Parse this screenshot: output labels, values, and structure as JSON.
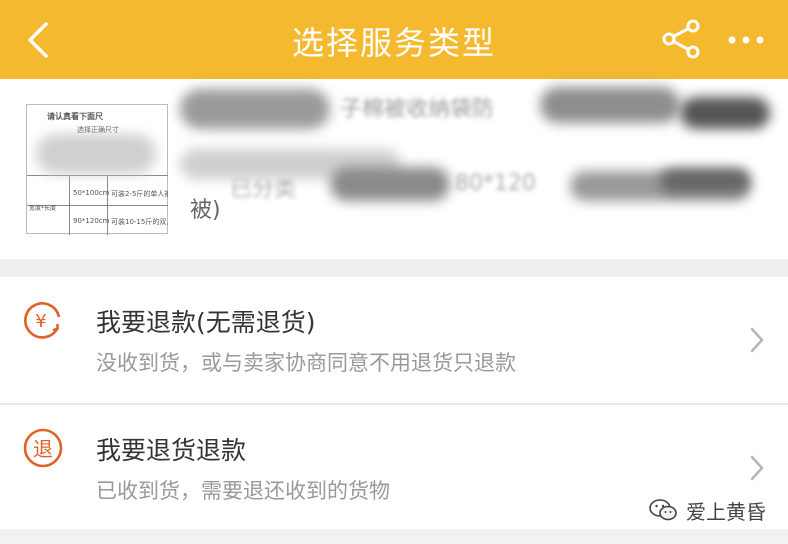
{
  "header": {
    "title": "选择服务类型",
    "back_icon": "chevron-left-icon",
    "share_icon": "share-icon",
    "more_icon": "more-horizontal-icon",
    "background_color": "#f5b930"
  },
  "product": {
    "title_visible_fragment": "子棉被收纳袋防",
    "spec_visible_fragment": "已分类",
    "size_fragment": "80*120",
    "tail_text": "被)",
    "thumbnail": {
      "header_text": "请认真看下面尺",
      "header_sub": "选择正确尺寸",
      "left_label": "宽度*长度",
      "size_row1": "50*100cm",
      "desc_row1": "可装2-5斤的单人被",
      "size_row2": "90*120cm",
      "desc_row2": "可装10-15斤的双人"
    }
  },
  "options": [
    {
      "icon": "yuan-refund-icon",
      "icon_glyph": "¥",
      "title": "我要退款(无需退货)",
      "subtitle": "没收到货，或与卖家协商同意不用退货只退款"
    },
    {
      "icon": "return-goods-icon",
      "icon_glyph": "退",
      "title": "我要退货退款",
      "subtitle": "已收到货，需要退还收到的货物"
    }
  ],
  "accent_color": "#e0622a",
  "watermark": {
    "icon": "wechat-icon",
    "text": "爱上黄昏"
  }
}
